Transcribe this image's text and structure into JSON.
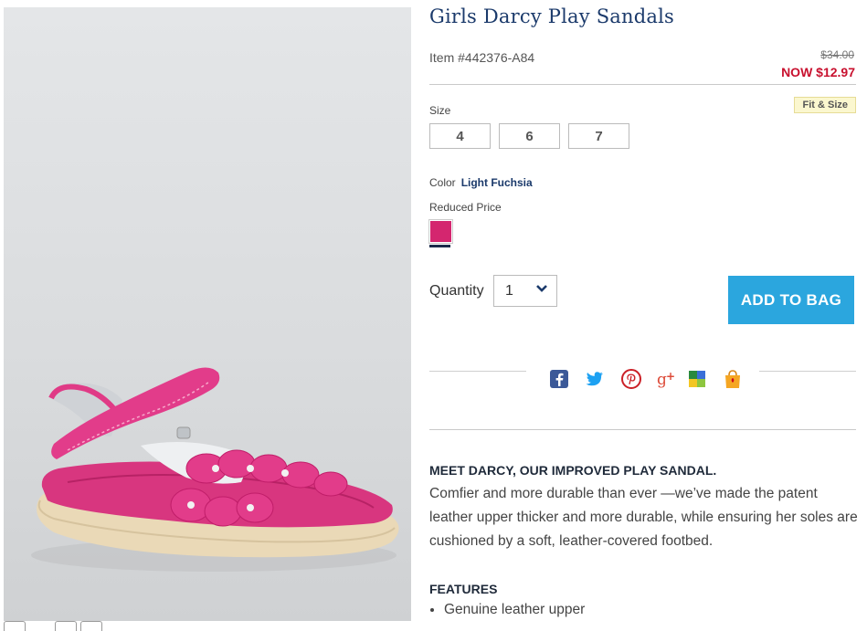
{
  "product": {
    "title": "Girls Darcy Play Sandals",
    "item_number": "Item #442376-A84",
    "original_price": "$34.00",
    "sale_price": "NOW $12.97"
  },
  "size": {
    "label": "Size",
    "fit_link": "Fit & Size",
    "options": [
      "4",
      "6",
      "7"
    ]
  },
  "color": {
    "label": "Color",
    "selected": "Light Fuchsia",
    "price_group": "Reduced Price",
    "swatch_color": "#d4266f"
  },
  "quantity": {
    "label": "Quantity",
    "value": "1"
  },
  "add_to_bag_label": "ADD TO BAG",
  "share_icons": [
    "facebook-icon",
    "twitter-icon",
    "pinterest-icon",
    "google-plus-icon",
    "colorful-grid-icon",
    "shopping-bag-icon"
  ],
  "description": {
    "heading": "MEET DARCY, OUR IMPROVED PLAY SANDAL.",
    "body": "Comfier and more durable than ever —we’ve made the patent leather upper thicker and more durable, while ensuring her soles are cushioned by a soft, leather-covered footbed."
  },
  "features": {
    "heading": "FEATURES",
    "items": [
      "Genuine leather upper"
    ]
  },
  "colors": {
    "title": "#1b3a6b",
    "sale": "#c8102e",
    "button": "#2ba6de",
    "swatch": "#d4266f"
  }
}
